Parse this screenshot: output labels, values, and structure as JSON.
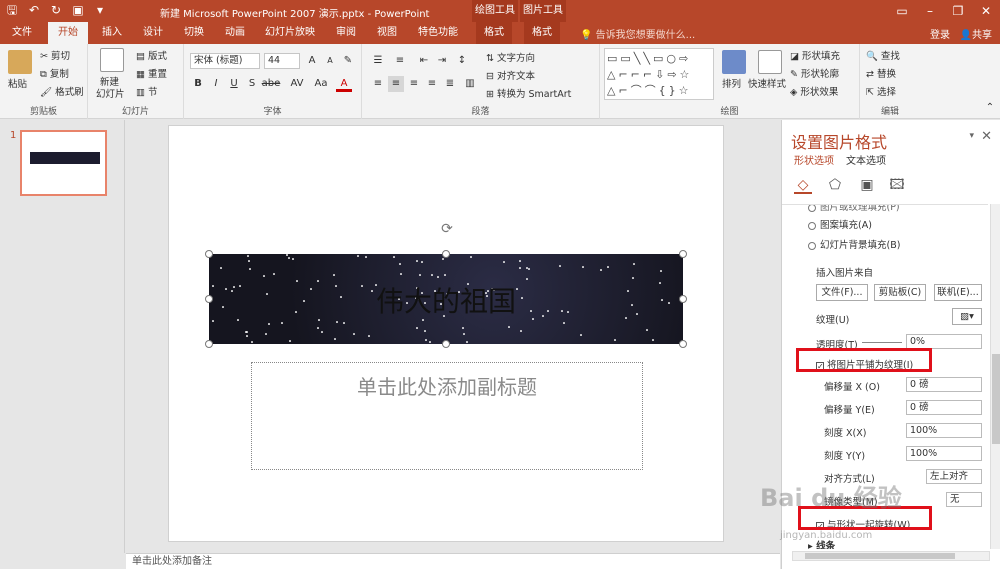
{
  "window": {
    "title": "新建 Microsoft PowerPoint 2007 演示.pptx - PowerPoint",
    "context_tabs": [
      "绘图工具",
      "图片工具"
    ]
  },
  "qat_icons": [
    "save-icon",
    "undo-icon",
    "redo-icon",
    "slideshow-icon",
    "customize-icon"
  ],
  "tabs": [
    "文件",
    "开始",
    "插入",
    "设计",
    "切换",
    "动画",
    "幻灯片放映",
    "审阅",
    "视图",
    "特色功能",
    "格式",
    "格式"
  ],
  "active_tab": "开始",
  "tell_me": "告诉我您想要做什么...",
  "account": {
    "login": "登录",
    "share": "共享"
  },
  "ribbon": {
    "clipboard": {
      "label": "剪贴板",
      "paste": "粘贴",
      "cut": "剪切",
      "copy": "复制",
      "format_painter": "格式刷"
    },
    "slides": {
      "label": "幻灯片",
      "new_slide": "新建\n幻灯片",
      "new_slide_line1": "新建",
      "new_slide_line2": "幻灯片",
      "layout": "版式",
      "reset": "重置",
      "section": "节"
    },
    "font": {
      "label": "字体",
      "font_name": "宋体 (标题)",
      "font_size": "44",
      "bold": "B",
      "italic": "I",
      "underline": "U",
      "strike": "S",
      "shadow": "abe",
      "spacing": "AV",
      "case": "Aa",
      "color": "A"
    },
    "paragraph": {
      "label": "段落",
      "text_direction": "文字方向",
      "align_text": "对齐文本",
      "smartart": "转换为 SmartArt"
    },
    "drawing": {
      "label": "绘图",
      "arrange": "排列",
      "quick_styles": "快速样式",
      "shape_fill": "形状填充",
      "shape_outline": "形状轮廓",
      "shape_effects": "形状效果"
    },
    "editing": {
      "label": "编辑",
      "find": "查找",
      "replace": "替换",
      "select": "选择"
    }
  },
  "slides_pane": {
    "slide_number": "1"
  },
  "slide": {
    "title": "伟大的祖国",
    "subtitle_placeholder": "单击此处添加副标题"
  },
  "notes_placeholder": "单击此处添加备注",
  "format_pane": {
    "title": "设置图片格式",
    "tab_shape": "形状选项",
    "tab_text": "文本选项",
    "fill_options": [
      "图片或纹理填充(P)",
      "图案填充(A)",
      "幻灯片背景填充(B)"
    ],
    "insert_from": "插入图片来自",
    "buttons": {
      "file": "文件(F)...",
      "clipboard": "剪贴板(C)",
      "online": "联机(E)..."
    },
    "texture_label": "纹理(U)",
    "transparency_label": "透明度(T)",
    "transparency_value": "0%",
    "tile_checkbox": "将图片平铺为纹理(I)",
    "tile_checked": true,
    "offset_x_label": "偏移量 X (O)",
    "offset_x_value": "0 磅",
    "offset_y_label": "偏移量 Y(E)",
    "offset_y_value": "0 磅",
    "scale_x_label": "刻度 X(X)",
    "scale_x_value": "100%",
    "scale_y_label": "刻度 Y(Y)",
    "scale_y_value": "100%",
    "align_label": "对齐方式(L)",
    "align_value": "左上对齐",
    "mirror_label": "镜像类型(M)",
    "mirror_value": "无",
    "rotate_checkbox": "与形状一起旋转(W)",
    "rotate_checked": true,
    "line_label": "线条"
  },
  "watermark": {
    "text": "Bai du 经验",
    "sub": "jingyan.baidu.com"
  },
  "colors": {
    "accent": "#b7472a",
    "highlight": "#e0101a"
  }
}
